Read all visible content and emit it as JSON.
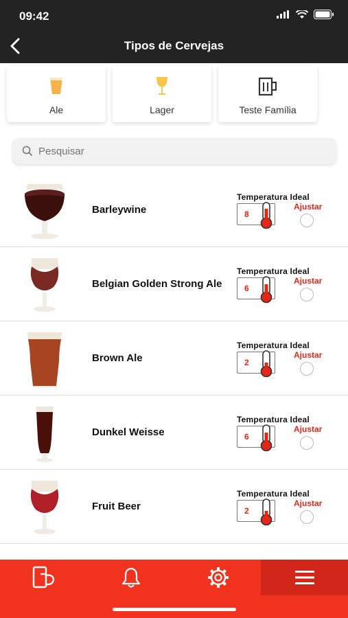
{
  "status": {
    "time": "09:42"
  },
  "nav": {
    "title": "Tipos de Cervejas"
  },
  "categories": [
    {
      "label": "Ale",
      "icon": "ale-glass-icon"
    },
    {
      "label": "Lager",
      "icon": "lager-glass-icon"
    },
    {
      "label": "Teste Família",
      "icon": "mug-icon"
    }
  ],
  "search": {
    "placeholder": "Pesquisar"
  },
  "temp_title": "Temperatura Ideal",
  "adjust_label": "Ajustar",
  "beers": [
    {
      "name": "Barleywine",
      "temp": "8",
      "glass": "snifter",
      "color": "#3b0f0c"
    },
    {
      "name": "Belgian Golden Strong Ale",
      "temp": "6",
      "glass": "tulip",
      "color": "#7a2a22"
    },
    {
      "name": "Brown Ale",
      "temp": "2",
      "glass": "pint",
      "color": "#a8441f"
    },
    {
      "name": "Dunkel Weisse",
      "temp": "6",
      "glass": "weizen",
      "color": "#4a0f08"
    },
    {
      "name": "Fruit Beer",
      "temp": "2",
      "glass": "tulip",
      "color": "#b01e28"
    }
  ],
  "tabbar": {
    "icons": [
      "phone-beer-icon",
      "bell-icon",
      "gear-icon",
      "menu-icon"
    ],
    "active_index": 3
  },
  "colors": {
    "accent": "#f0321f",
    "header_bg": "#232323",
    "temp_red": "#e32618"
  }
}
